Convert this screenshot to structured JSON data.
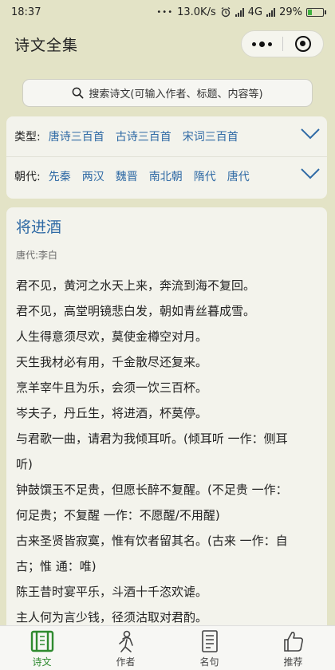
{
  "status_bar": {
    "time": "18:37",
    "dots": "•••",
    "network_speed": "13.0K/s",
    "network_type": "4G",
    "battery_percent": "29%",
    "battery_level": 0.29
  },
  "nav": {
    "title": "诗文全集"
  },
  "search": {
    "placeholder": "搜索诗文(可输入作者、标题、内容等)"
  },
  "filter": {
    "type_label": "类型:",
    "types": [
      "唐诗三百首",
      "古诗三百首",
      "宋词三百首"
    ],
    "dynasty_label": "朝代:",
    "dynasties": [
      "先秦",
      "两汉",
      "魏晋",
      "南北朝",
      "隋代",
      "唐代"
    ]
  },
  "poem": {
    "title": "将进酒",
    "meta": "唐代:李白",
    "lines": [
      "君不见，黄河之水天上来，奔流到海不复回。",
      "君不见，高堂明镜悲白发，朝如青丝暮成雪。",
      "人生得意须尽欢，莫使金樽空对月。",
      "天生我材必有用，千金散尽还复来。",
      "烹羊宰牛且为乐，会须一饮三百杯。",
      "岑夫子，丹丘生，将进酒，杯莫停。",
      "与君歌一曲，请君为我倾耳听。(倾耳听 一作：侧耳",
      "听)",
      "钟鼓馔玉不足贵，但愿长醉不复醒。(不足贵 一作：",
      "何足贵；不复醒 一作：不愿醒/不用醒)",
      "古来圣贤皆寂寞，惟有饮者留其名。(古来 一作：自",
      "古；惟 通：唯)",
      "陈王昔时宴平乐，斗酒十千恣欢谑。",
      "主人何为言少钱，径须沽取对君酌。"
    ]
  },
  "tabbar": {
    "items": [
      {
        "label": "诗文",
        "icon": "poem-book-icon",
        "active": true
      },
      {
        "label": "作者",
        "icon": "author-icon",
        "active": false
      },
      {
        "label": "名句",
        "icon": "quote-doc-icon",
        "active": false
      },
      {
        "label": "推荐",
        "icon": "thumbs-up-icon",
        "active": false
      }
    ]
  },
  "colors": {
    "background": "#e3e3c6",
    "link": "#2f6aa5",
    "active_tab": "#2f8a2f"
  }
}
